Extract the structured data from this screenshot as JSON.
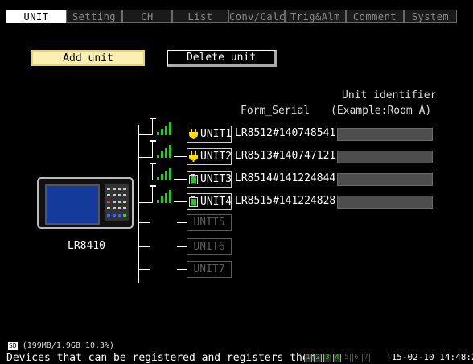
{
  "tabs": [
    {
      "label": "UNIT",
      "active": true
    },
    {
      "label": "Setting",
      "active": false
    },
    {
      "label": "CH",
      "active": false
    },
    {
      "label": "List",
      "active": false
    },
    {
      "label": "Conv/Calc",
      "active": false
    },
    {
      "label": "Trig&Alm",
      "active": false
    },
    {
      "label": "Comment",
      "active": false
    },
    {
      "label": "System",
      "active": false
    }
  ],
  "buttons": {
    "add_unit": "Add unit",
    "delete_unit": "Delete unit"
  },
  "headers": {
    "form_serial": "Form_Serial",
    "unit_identifier": "Unit identifier",
    "identifier_example": "(Example:Room A)"
  },
  "device": {
    "label": "LR8410"
  },
  "units": [
    {
      "label": "UNIT1",
      "serial": "LR8512#140748541",
      "icon": "plug-icon",
      "color": "#ffe000",
      "identifier": "",
      "signal_bars": 4
    },
    {
      "label": "UNIT2",
      "serial": "LR8513#140747121",
      "icon": "plug-icon",
      "color": "#ffe000",
      "identifier": "",
      "signal_bars": 4
    },
    {
      "label": "UNIT3",
      "serial": "LR8514#141224844",
      "icon": "battery-icon",
      "color": "#22cc22",
      "identifier": "",
      "signal_bars": 4
    },
    {
      "label": "UNIT4",
      "serial": "LR8515#141224828",
      "icon": "battery-icon",
      "color": "#22cc22",
      "identifier": "",
      "signal_bars": 4
    },
    {
      "label": "UNIT5",
      "serial": "",
      "icon": "",
      "identifier": ""
    },
    {
      "label": "UNIT6",
      "serial": "",
      "icon": "",
      "identifier": ""
    },
    {
      "label": "UNIT7",
      "serial": "",
      "icon": "",
      "identifier": ""
    }
  ],
  "status": {
    "storage": "(199MB/1.9GB 10.3%)",
    "message": "Devices that can be registered and registers them.",
    "datetime": "'15-02-10 14:48:24",
    "slots": [
      "1",
      "2",
      "3",
      "4",
      "5",
      "6",
      "7"
    ],
    "active_slots": 4
  },
  "colors": {
    "accent": "#fbf0b4",
    "signal": "#22cc22",
    "ident_field": "#4d4d4d"
  }
}
